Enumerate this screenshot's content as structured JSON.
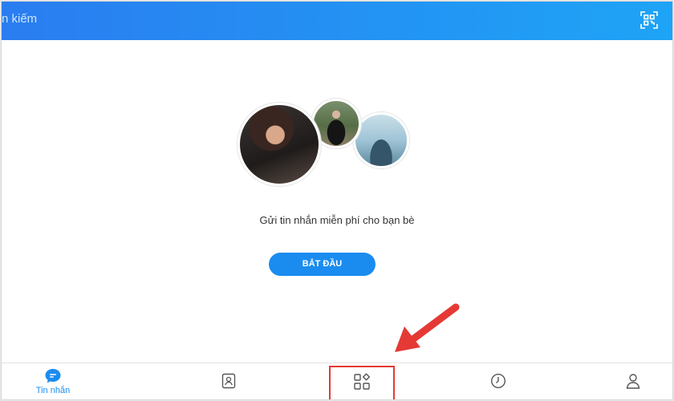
{
  "topbar": {
    "search_placeholder": "n kiếm",
    "qr_icon": "qr-scan-icon"
  },
  "main": {
    "message": "Gửi tin nhắn miễn phí cho bạn bè",
    "start_button": "BẮT ĐẦU"
  },
  "bottom_nav": {
    "items": [
      {
        "id": "messages",
        "label": "Tin nhắn",
        "icon": "chat-bubble-icon",
        "active": true
      },
      {
        "id": "contacts",
        "label": "",
        "icon": "contacts-icon",
        "active": false
      },
      {
        "id": "discover",
        "label": "",
        "icon": "grid-apps-icon",
        "active": false
      },
      {
        "id": "timeline",
        "label": "",
        "icon": "clock-icon",
        "active": false
      },
      {
        "id": "profile",
        "label": "",
        "icon": "person-icon",
        "active": false
      }
    ]
  },
  "colors": {
    "accent": "#1a8cf0",
    "topbar_start": "#2a7df0",
    "topbar_end": "#1ea4f6",
    "annotation": "#e53935"
  }
}
